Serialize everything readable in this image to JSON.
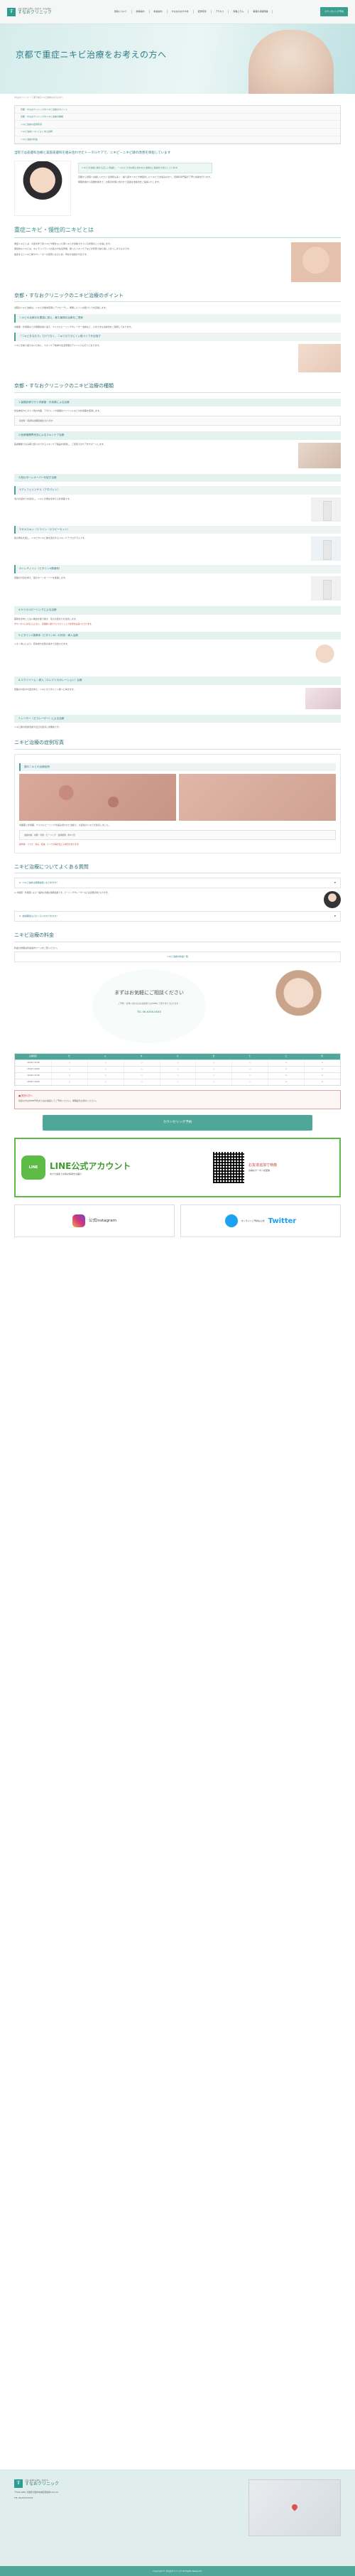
{
  "header": {
    "logo_sub": "大阪心斎橋院 皮膚科・形成外科・美容皮膚科",
    "logo_name": "すなおクリニック",
    "nav": [
      "当院について",
      "診療案内",
      "料金案内",
      "すなおのおすすめ",
      "症例写真",
      "アクセス",
      "院長コラム",
      "美容の基礎知識"
    ],
    "cta": "カウンセリング予約"
  },
  "hero": {
    "title": "京都で重症ニキビ治療をお考えの方へ"
  },
  "breadcrumb": "すなおクリニック ＞ 京都で重症ニキビ治療をお考えの方へ",
  "toc": [
    "京都・すなおクリニックのニキビ治療のポイント",
    "京都・すなおクリニックのニキビ治療の種類",
    "ニキビ治療の症例写真",
    "ニキビ治療についてよくある質問",
    "ニキビ治療の料金"
  ],
  "intro": {
    "lead": "当院では皮膚科治療と美容皮膚科を組み合わせたトータルケアで、ニキビ・ニキビ跡の改善を目指しています",
    "highlight": "ニキビの治療に関する正しい知識と、一人ひとりのお肌に合わせた治療のご提案を大切にしています。",
    "p1": "京都から当院へお越しいただく患者様も多く、繰り返すニキビや重症化したニキビでお悩みの方へ、皮膚科専門医が丁寧に診察を行います。",
    "p2": "保険診療から自費診療まで、お肌の状態に合わせて最適な治療法をご提案いたします。"
  },
  "section_acne": {
    "title": "重症ニキビ・慢性的ニキビとは",
    "p1": "重症ニキビとは、炎症を伴う赤ニキビや膿をもった黄ニキビが多数できている状態のことを指します。",
    "p2": "慢性的なニキビは、ホルモンバランスの乱れや生活習慣、誤ったスキンケアなどが原因で繰り返しできてしまうものです。",
    "p3": "放置するとニキビ跡やクレーターの原因となるため、早めの治療が大切です。"
  },
  "section_points": {
    "title": "京都・すなおクリニックのニキビ治療のポイント",
    "intro": "当院のニキビ治療は、ニキビの根本原因にアプローチし、再発しにくいお肌づくりを目指します。",
    "h1": "ニキビの治療法を豊富に揃え、最も最適な治療をご提案",
    "p1": "内服薬・外用薬などの保険診療に加え、ケミカルピーリングやレーザー治療など、さまざまな治療法をご用意しております。",
    "h2": "「ニキビをなおす」だけでなく、ニキビのできにくい肌づくりを目指す",
    "p2": "ニキビを繰り返さないために、スキンケア指導や生活習慣のアドバイスも行っております。"
  },
  "section_types": {
    "title": "京都・すなおクリニックのニキビ治療の種類",
    "t1": "1.保険診療で行う内服薬・外用薬による治療",
    "p1": "抗生物質やビタミン剤の内服、アダパレンや過酸化ベンゾイルなどの外用薬を使用します。",
    "price1": "初診料・再診料は保険適用となります",
    "t2": "2.医療機関専売品によるスキンケア治療",
    "p2": "医療機関でのみ取り扱いのできるスキンケア製品を使用し、ご自宅でのケアをサポートします。",
    "t3": "3.肌のターンオーバーを促す治療",
    "products": [
      {
        "name": "①ディフェリンゲル（アダパレン）",
        "desc": "毛穴の詰まりを改善し、ニキビの発生を抑える外用薬です。"
      },
      {
        "name": "②ゼオスキン（ミラミン・セラピーセット）",
        "desc": "肌の再生を促し、ニキビやニキビ跡を改善するスキンケアプログラムです。"
      },
      {
        "name": "③トレチノイン（ビタミンA誘導体）",
        "desc": "皮脂の分泌を抑え、肌のターンオーバーを促進します。"
      }
    ],
    "t4": "4.ケミカルピーリングによる治療",
    "p4": "薬剤を塗布して古い角質を取り除き、毛穴の詰まりを改善します。",
    "note4": "ダウンタイムがほとんどなく、定期的に受けていただくことで効果を実感いただけます。",
    "t5": "5.ビタミンC誘導体（ビタミンB）の外用・導入治療",
    "p5": "イオン導入により、有効成分を肌の奥まで浸透させます。",
    "t6": "6.エクソソーム・導入（エレクトロポレーション）治療",
    "p6": "皮脂の分泌や炎症を抑え、ニキビのできにくい肌へと導きます。",
    "t7": "7.レーザー（ピコレーザー）による治療",
    "p7": "ニキビ跡の色素沈着や凹凸の改善に効果的です。"
  },
  "section_cases": {
    "title": "ニキビ治療の症例写真",
    "label": "顔のニキビの治療症例",
    "desc": "内服薬と外用薬、ケミカルピーリングを組み合わせた治療で、炎症性のニキビが改善しました。",
    "info": "治療内容：内服・外用・ピーリング　治療期間：約3ヶ月",
    "risk": "副作用・リスク：赤み、乾燥、ヒリつき等が生じる場合があります。"
  },
  "section_faq": {
    "title": "ニキビ治療についてよくある質問",
    "q1": "Q. ニキビ治療は保険適用になりますか？",
    "a1": "A. 内服薬・外用薬による一般的な治療は保険適用です。ピーリングやレーザーなどは自費診療となります。",
    "q2": "Q. 治療期間はどのくらいかかりますか？"
  },
  "section_price": {
    "title": "ニキビ治療の料金",
    "intro": "料金の詳細は料金案内ページをご覧ください。",
    "button": "ニキビ治療の料金一覧"
  },
  "consult": {
    "title": "まずはお気軽にご相談ください",
    "sub": "ご予約・お問い合わせはお電話またはWEBにて受け付けております。",
    "phone": "TEL 06-XXXX-XXXX"
  },
  "schedule": {
    "head": [
      "診療時間",
      "月",
      "火",
      "水",
      "木",
      "金",
      "土",
      "日",
      "祝"
    ],
    "rows": [
      [
        "10:00〜13:30",
        "○",
        "○",
        "○",
        "○",
        "○",
        "○",
        "×",
        "×"
      ],
      [
        "15:00〜19:00",
        "○",
        "○",
        "○",
        "○",
        "○",
        "○",
        "×",
        "×"
      ],
      [
        "10:00〜13:30",
        "○",
        "○",
        "○",
        "○",
        "○",
        "○",
        "×",
        "×"
      ],
      [
        "15:00〜19:00",
        "○",
        "○",
        "○",
        "○",
        "○",
        "○",
        "×",
        "×"
      ]
    ]
  },
  "alert": {
    "title": "■ 受診の方へ",
    "body": "初診の方はWEB予約またはお電話にてご予約ください。保険証をお持ちください。"
  },
  "cta_big": "カウンセリング予約",
  "line": {
    "logo": "LINE",
    "title": "LINE公式アカウント",
    "sub": "友だち追加でお得な情報をお届け",
    "right_title": "お友達追加で特典",
    "right_sub": "お得なクーポンを配信"
  },
  "social": {
    "insta": "公式Instagram",
    "twitter_label": "オンラインご予約も公式",
    "twitter": "Twitter"
  },
  "footer": {
    "logo_sub": "大阪心斎橋院 皮膚科・形成外科",
    "logo_name": "すなおクリニック",
    "addr": "〒542-0081 大阪府大阪市中央区南船場3-XX-XX",
    "tel": "TEL 06-XXXX-XXXX",
    "copy": "Copyright © すなおクリニック All Rights Reserved."
  }
}
